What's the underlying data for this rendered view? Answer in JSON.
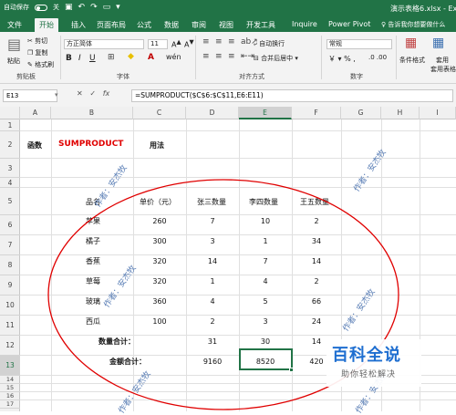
{
  "title_bar": {
    "autosave": "自动保存",
    "autosave_state": "关",
    "file_name": "演示表格6.xlsx - Exc"
  },
  "tabs": [
    "文件",
    "开始",
    "插入",
    "页面布局",
    "公式",
    "数据",
    "审阅",
    "视图",
    "开发工具",
    "Inquire",
    "Power Pivot"
  ],
  "active_tab": "开始",
  "tell_me": "告诉我你想要做什么",
  "ribbon": {
    "paste": "粘贴",
    "cut": "剪切",
    "copy": "复制",
    "format_painter": "格式刷",
    "clipboard_group": "剪贴板",
    "font_name": "方正简体",
    "font_size": "11",
    "font_group": "字体",
    "wrap_text": "自动换行",
    "merge_center": "合并后居中",
    "align_group": "对齐方式",
    "number_format": "常规",
    "number_group": "数字",
    "conditional_format": "条件格式",
    "table_format": "套用表格格式"
  },
  "formula_bar": {
    "name_box": "E13",
    "fx": "fx",
    "formula": "=SUMPRODUCT($C$6:$C$11,E6:E11)"
  },
  "columns": [
    "A",
    "B",
    "C",
    "D",
    "E",
    "F",
    "G",
    "H",
    "I"
  ],
  "rows": [
    "1",
    "2",
    "3",
    "4",
    "5",
    "6",
    "7",
    "8",
    "9",
    "10",
    "11",
    "12",
    "13",
    "14",
    "15",
    "16",
    "17"
  ],
  "sheet": {
    "row2": {
      "label": "函数",
      "func": "SUMPRODUCT",
      "usage": "用法"
    },
    "headers": {
      "product": "品名",
      "price": "单价（元）",
      "zhang": "张三数量",
      "li": "李四数量",
      "wang": "王五数量"
    },
    "items": [
      {
        "name": "苹果",
        "price": "260",
        "d": "7",
        "e": "10",
        "f": "2"
      },
      {
        "name": "橘子",
        "price": "300",
        "d": "3",
        "e": "1",
        "f": "34"
      },
      {
        "name": "香蕉",
        "price": "320",
        "d": "14",
        "e": "7",
        "f": "14"
      },
      {
        "name": "草莓",
        "price": "320",
        "d": "1",
        "e": "4",
        "f": "2"
      },
      {
        "name": "玻璃",
        "price": "360",
        "d": "4",
        "e": "5",
        "f": "66"
      },
      {
        "name": "西瓜",
        "price": "100",
        "d": "2",
        "e": "3",
        "f": "24"
      }
    ],
    "qty_total": {
      "label": "数量合计：",
      "d": "31",
      "e": "30",
      "f": "14"
    },
    "amount_total": {
      "label": "金额合计：",
      "d": "9160",
      "e": "8520",
      "f": "420"
    }
  },
  "watermark": "作者：安杰牧",
  "logo": {
    "main": "百科全说",
    "sub": "助你轻松解决"
  },
  "colors": {
    "excel_green": "#217346",
    "accent_red": "#e00000",
    "watermark_blue": "#5b7fb6"
  }
}
